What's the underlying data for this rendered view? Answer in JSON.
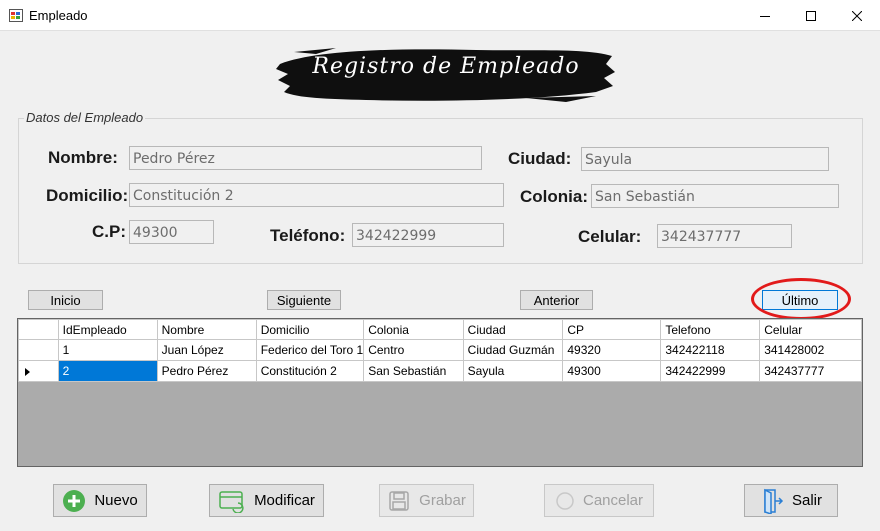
{
  "window": {
    "title": "Empleado"
  },
  "banner": {
    "title": "Registro de Empleado"
  },
  "group": {
    "legend": "Datos del Empleado"
  },
  "form": {
    "nombre_label": "Nombre:",
    "nombre_value": "Pedro Pérez",
    "ciudad_label": "Ciudad:",
    "ciudad_value": "Sayula",
    "domicilio_label": "Domicilio:",
    "domicilio_value": "Constitución 2",
    "colonia_label": "Colonia:",
    "colonia_value": "San Sebastián",
    "cp_label": "C.P:",
    "cp_value": "49300",
    "telefono_label": "Teléfono:",
    "telefono_value": "342422999",
    "celular_label": "Celular:",
    "celular_value": "342437777"
  },
  "nav": {
    "inicio": "Inicio",
    "siguiente": "Siguiente",
    "anterior": "Anterior",
    "ultimo": "Último"
  },
  "grid": {
    "columns": [
      "IdEmpleado",
      "Nombre",
      "Domicilio",
      "Colonia",
      "Ciudad",
      "CP",
      "Telefono",
      "Celular"
    ],
    "rows": [
      [
        "1",
        "Juan López",
        "Federico del Toro 1",
        "Centro",
        "Ciudad Guzmán",
        "49320",
        "342422118",
        "341428002"
      ],
      [
        "2",
        "Pedro Pérez",
        "Constitución 2",
        "San Sebastián",
        "Sayula",
        "49300",
        "342422999",
        "342437777"
      ]
    ]
  },
  "actions": {
    "nuevo": "Nuevo",
    "modificar": "Modificar",
    "grabar": "Grabar",
    "cancelar": "Cancelar",
    "salir": "Salir"
  },
  "colors": {
    "selection": "#0078d7",
    "annotation_ring": "#e21a1a",
    "nuevo_icon": "#4caf50"
  }
}
